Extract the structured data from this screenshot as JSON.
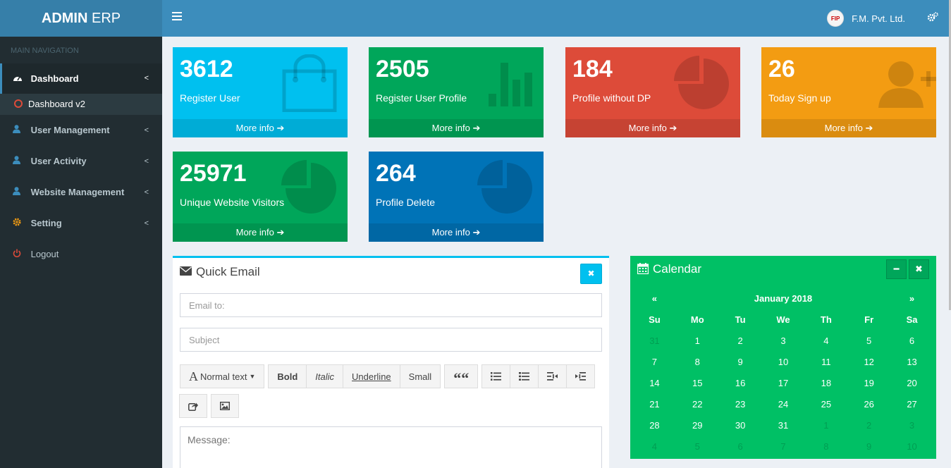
{
  "brand": {
    "bold": "ADMIN",
    "rest": " ERP"
  },
  "header": {
    "company": "F.M. Pvt. Ltd.",
    "avatar_text": "FIP"
  },
  "sidebar": {
    "header": "MAIN NAVIGATION",
    "dashboard": "Dashboard",
    "dashboard_v2": "Dashboard v2",
    "user_management": "User Management",
    "user_activity": "User Activity",
    "website_management": "Website Management",
    "setting": "Setting",
    "logout": "Logout"
  },
  "stats": [
    {
      "value": "3612",
      "label": "Register User",
      "more": "More info",
      "color": "#00c0ef",
      "icon": "shopping-bag-icon"
    },
    {
      "value": "2505",
      "label": "Register User Profile",
      "more": "More info",
      "color": "#00a65a",
      "icon": "bar-chart-icon"
    },
    {
      "value": "184",
      "label": "Profile without DP",
      "more": "More info",
      "color": "#dd4b39",
      "icon": "pie-chart-icon"
    },
    {
      "value": "26",
      "label": "Today Sign up",
      "more": "More info",
      "color": "#f39c12",
      "icon": "user-plus-icon"
    },
    {
      "value": "25971",
      "label": "Unique Website Visitors",
      "more": "More info",
      "color": "#00a65a",
      "icon": "pie-chart-icon"
    },
    {
      "value": "264",
      "label": "Profile Delete",
      "more": "More info",
      "color": "#0073b7",
      "icon": "pie-chart-icon"
    }
  ],
  "email": {
    "title": "Quick Email",
    "email_placeholder": "Email to:",
    "subject_placeholder": "Subject",
    "message_placeholder": "Message:",
    "toolbar": {
      "normal_text": "Normal text",
      "bold": "Bold",
      "italic": "Italic",
      "underline": "Underline",
      "small": "Small",
      "quote": "““"
    }
  },
  "calendar": {
    "title": "Calendar",
    "month": "January 2018",
    "prev": "«",
    "next": "»",
    "days": [
      "Su",
      "Mo",
      "Tu",
      "We",
      "Th",
      "Fr",
      "Sa"
    ],
    "weeks": [
      [
        "31",
        "1",
        "2",
        "3",
        "4",
        "5",
        "6"
      ],
      [
        "7",
        "8",
        "9",
        "10",
        "11",
        "12",
        "13"
      ],
      [
        "14",
        "15",
        "16",
        "17",
        "18",
        "19",
        "20"
      ],
      [
        "21",
        "22",
        "23",
        "24",
        "25",
        "26",
        "27"
      ],
      [
        "28",
        "29",
        "30",
        "31",
        "1",
        "2",
        "3"
      ],
      [
        "4",
        "5",
        "6",
        "7",
        "8",
        "9",
        "10"
      ]
    ]
  }
}
